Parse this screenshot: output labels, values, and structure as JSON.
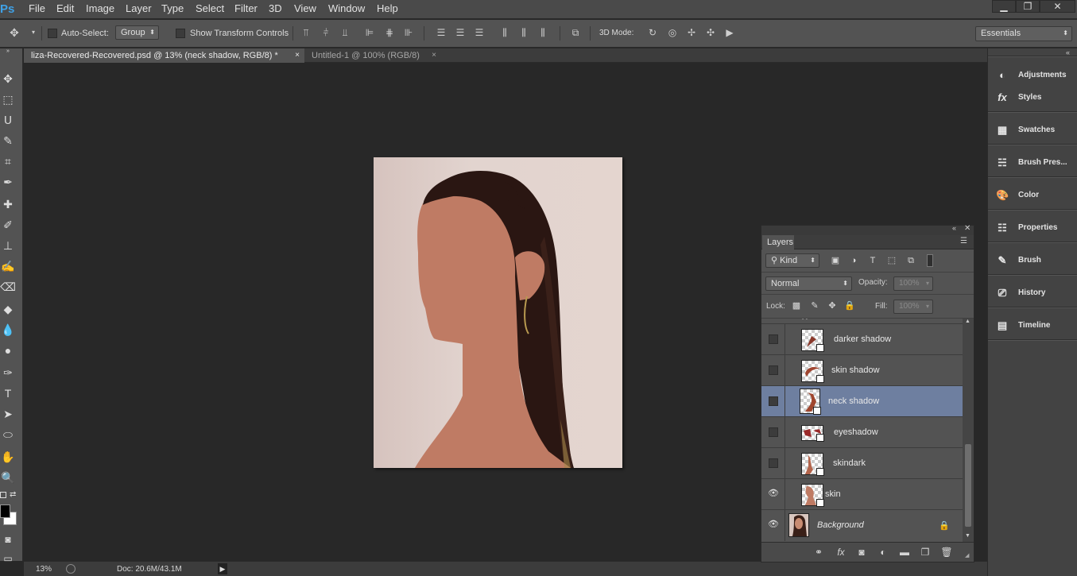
{
  "app": {
    "logo": "Ps"
  },
  "menu": [
    "File",
    "Edit",
    "Image",
    "Layer",
    "Type",
    "Select",
    "Filter",
    "3D",
    "View",
    "Window",
    "Help"
  ],
  "window_controls": {
    "minimize": "▁",
    "restore": "❐",
    "close": "✕"
  },
  "options": {
    "move_icon": "move-tool-icon",
    "auto_select_label": "Auto-Select:",
    "auto_select_value": "Group",
    "show_transform_label": "Show Transform Controls",
    "mode_3d_label": "3D Mode:",
    "workspace": "Essentials"
  },
  "tabs": [
    {
      "label": "liza-Recovered-Recovered.psd @ 13% (neck shadow, RGB/8) *",
      "close": "×",
      "active": true
    },
    {
      "label": "Untitled-1 @ 100% (RGB/8)",
      "close": "×",
      "active": false
    }
  ],
  "status": {
    "zoom": "13%",
    "doc": "Doc: 20.6M/43.1M",
    "arrow": "▶"
  },
  "dock": [
    "Adjustments",
    "Styles",
    "Swatches",
    "Brush Pres...",
    "Color",
    "Properties",
    "Brush",
    "History",
    "Timeline"
  ],
  "layers_panel": {
    "title": "Layers",
    "kind_label": "Kind",
    "blend_mode": "Normal",
    "opacity_label": "Opacity:",
    "opacity_value": "100%",
    "lock_label": "Lock:",
    "fill_label": "Fill:",
    "fill_value": "100%",
    "layers": [
      {
        "name": "darker shadow",
        "visible": false,
        "selected": false,
        "italic": false,
        "locked": false
      },
      {
        "name": "skin shadow",
        "visible": false,
        "selected": false,
        "italic": false,
        "locked": false
      },
      {
        "name": "neck shadow",
        "visible": false,
        "selected": true,
        "italic": false,
        "locked": false
      },
      {
        "name": "eyeshadow",
        "visible": false,
        "selected": false,
        "italic": false,
        "locked": false
      },
      {
        "name": "skindark",
        "visible": false,
        "selected": false,
        "italic": false,
        "locked": false
      },
      {
        "name": "skin",
        "visible": true,
        "selected": false,
        "italic": false,
        "locked": false
      },
      {
        "name": "Background",
        "visible": true,
        "selected": false,
        "italic": true,
        "locked": true
      }
    ]
  },
  "colors": {
    "selected_layer": "#6e7fa0",
    "skin": "#bf7b64",
    "hair": "#2a1612",
    "background_paper": "#e2d4cf"
  }
}
